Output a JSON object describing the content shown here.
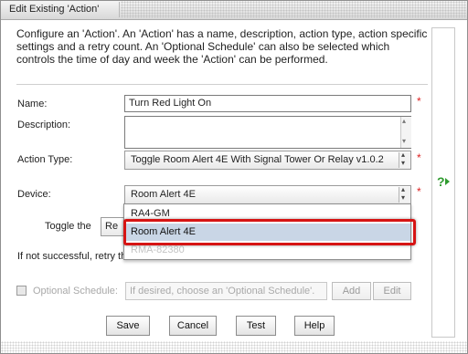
{
  "window": {
    "title": "Edit Existing 'Action'"
  },
  "intro": "Configure an 'Action'. An 'Action' has a name, description, action type, action specific settings and a retry count. An 'Optional Schedule' can also be selected which controls the time of day and week the 'Action' can be performed.",
  "form": {
    "name_label": "Name:",
    "name_value": "Turn Red Light On",
    "description_label": "Description:",
    "description_value": "",
    "action_type_label": "Action Type:",
    "action_type_value": "Toggle Room Alert 4E With Signal Tower Or Relay v1.0.2",
    "device_label": "Device:",
    "device_value": "Room Alert 4E",
    "toggle_label": "Toggle the",
    "toggle_value_partial": "Re",
    "retry_label_partial": "If not successful, retry th",
    "required_mark": "*"
  },
  "dropdown": {
    "options": [
      {
        "label": "RA4-GM",
        "state": "normal"
      },
      {
        "label": "Room Alert 4E",
        "state": "selected"
      },
      {
        "label": "RMA-82380",
        "state": "disabled"
      }
    ]
  },
  "schedule": {
    "label": "Optional Schedule:",
    "placeholder": "If desired, choose an 'Optional Schedule'.",
    "add_label": "Add",
    "edit_label": "Edit"
  },
  "buttons": {
    "save": "Save",
    "cancel": "Cancel",
    "test": "Test",
    "help": "Help"
  },
  "help_icon": "?",
  "colors": {
    "highlight": "#d61414",
    "selected_option": "#c9d6e6",
    "required": "#dd2222",
    "help_green": "#2f9b2f"
  }
}
